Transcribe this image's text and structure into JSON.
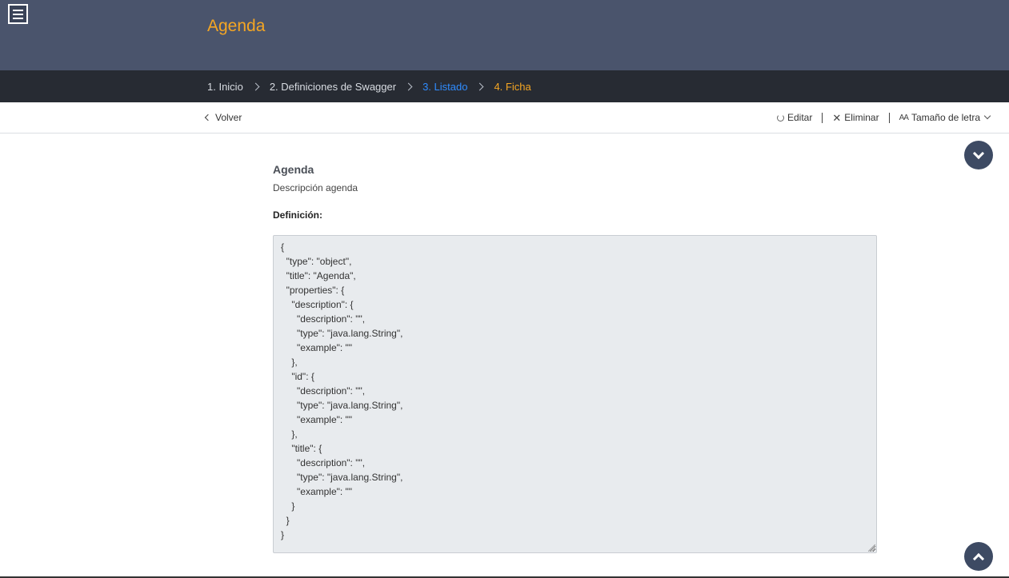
{
  "header": {
    "title": "Agenda"
  },
  "breadcrumb": [
    {
      "label": "1. Inicio",
      "state": "normal"
    },
    {
      "label": "2. Definiciones de Swagger",
      "state": "normal"
    },
    {
      "label": "3. Listado",
      "state": "active"
    },
    {
      "label": "4. Ficha",
      "state": "current"
    }
  ],
  "toolbar": {
    "back_label": "Volver",
    "edit_label": "Editar",
    "delete_label": "Eliminar",
    "font_size_label": "Tamaño de letra"
  },
  "content": {
    "title": "Agenda",
    "description": "Descripción agenda",
    "definition_label": "Definición:",
    "definition_code": "{\n  \"type\": \"object\",\n  \"title\": \"Agenda\",\n  \"properties\": {\n    \"description\": {\n      \"description\": \"\",\n      \"type\": \"java.lang.String\",\n      \"example\": \"\"\n    },\n    \"id\": {\n      \"description\": \"\",\n      \"type\": \"java.lang.String\",\n      \"example\": \"\"\n    },\n    \"title\": {\n      \"description\": \"\",\n      \"type\": \"java.lang.String\",\n      \"example\": \"\"\n    }\n  }\n}"
  },
  "colors": {
    "header_bg": "#4a546c",
    "breadcrumb_bg": "#272b33",
    "accent_orange": "#f5a623",
    "accent_blue": "#2f8cff",
    "fab_bg": "#3d4a63",
    "code_bg": "#e8ebee"
  },
  "icons": {
    "menu": "hamburger-icon",
    "edit": "refresh-icon",
    "delete": "close-icon",
    "font_size": "font-size-icon",
    "scroll_down": "chevron-down-icon",
    "scroll_up": "chevron-up-icon"
  }
}
